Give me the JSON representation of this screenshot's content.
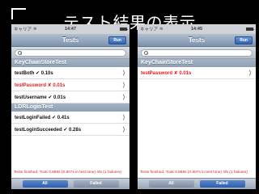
{
  "slide": {
    "title": "テスト結果の表示"
  },
  "left": {
    "status": {
      "carrier": "キャリア",
      "time": "14:47"
    },
    "nav": {
      "title": "Tests",
      "run_label": "Run"
    },
    "sections": [
      {
        "header": "KeyChainStoreTest",
        "rows": [
          {
            "label": "testBoth ✔ 0.10s",
            "status": "passed"
          },
          {
            "label": "testPassword ✘ 0.01s",
            "status": "failed"
          },
          {
            "label": "testUsername ✔ 0.01s",
            "status": "passed"
          }
        ]
      },
      {
        "header": "LDRLoginTest",
        "rows": [
          {
            "label": "testLoginFailed ✔ 0.41s",
            "status": "passed"
          },
          {
            "label": "testLoginSucceeded ✔ 0.28s",
            "status": "passed"
          }
        ]
      }
    ],
    "footer": "Tests finished. Took 0.888s (0.807s in test time) 4/5 (1 failures)",
    "tabs": {
      "all": "All",
      "failed": "Failed"
    }
  },
  "right": {
    "status": {
      "carrier": "キャリア",
      "time": "14:45"
    },
    "nav": {
      "title": "Tests",
      "run_label": "Run"
    },
    "sections": [
      {
        "header": "KeyChainStoreTest",
        "rows": [
          {
            "label": "testPassword ✘ 0.01s",
            "status": "failed"
          }
        ]
      }
    ],
    "footer": "Tests finished. Took 0.888s (0.807s in test time) 4/5 (1 failures)",
    "tabs": {
      "all": "All",
      "failed": "Failed"
    }
  }
}
